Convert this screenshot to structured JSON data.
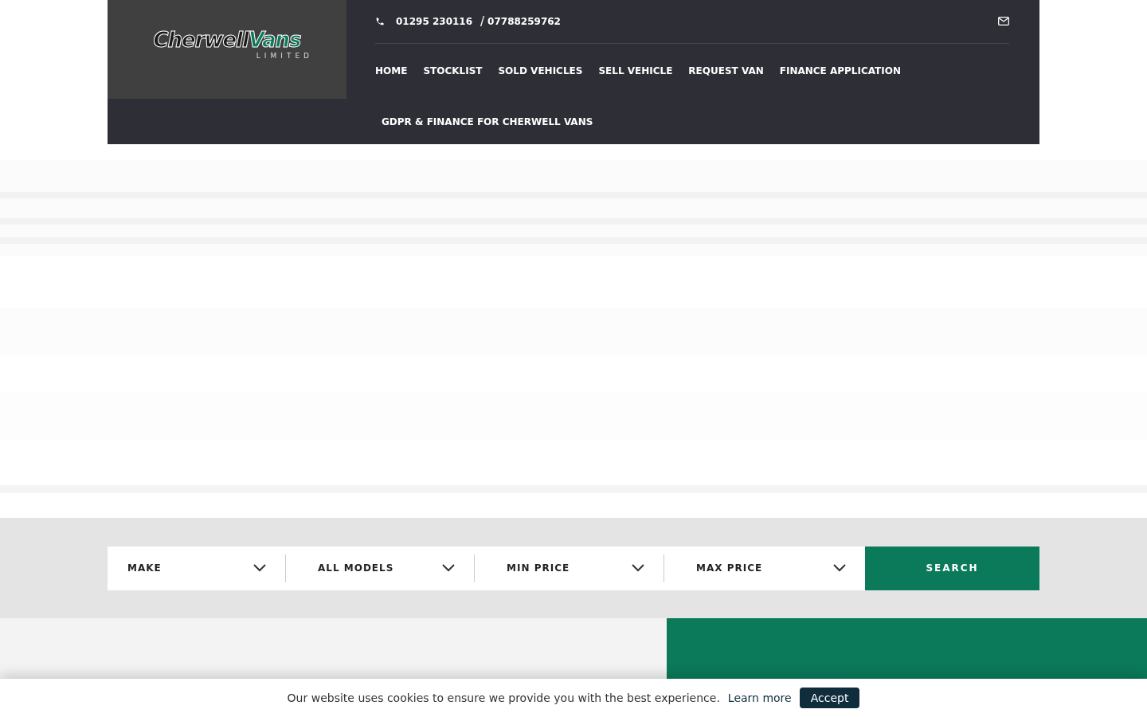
{
  "header": {
    "logo": {
      "name": "Cherwell",
      "highlight": "Vans",
      "subtitle": "LIMITED"
    },
    "phone": "01295 230116",
    "separator": "/",
    "mobile": "07788259762",
    "nav": [
      {
        "label": "HOME"
      },
      {
        "label": "STOCKLIST"
      },
      {
        "label": "SOLD VEHICLES"
      },
      {
        "label": "SELL VEHICLE"
      },
      {
        "label": "REQUEST VAN"
      },
      {
        "label": "FINANCE APPLICATION"
      }
    ],
    "nav_second_row": [
      {
        "label": "GDPR & FINANCE FOR CHERWELL VANS"
      }
    ]
  },
  "search": {
    "selects": [
      {
        "label": "MAKE"
      },
      {
        "label": "ALL MODELS"
      },
      {
        "label": "MIN PRICE"
      },
      {
        "label": "MAX PRICE"
      }
    ],
    "button": "SEARCH"
  },
  "cookie_bar": {
    "message": "Our website uses cookies to ensure we provide you with the best experience.",
    "link": "Learn more",
    "button": "Accept"
  }
}
